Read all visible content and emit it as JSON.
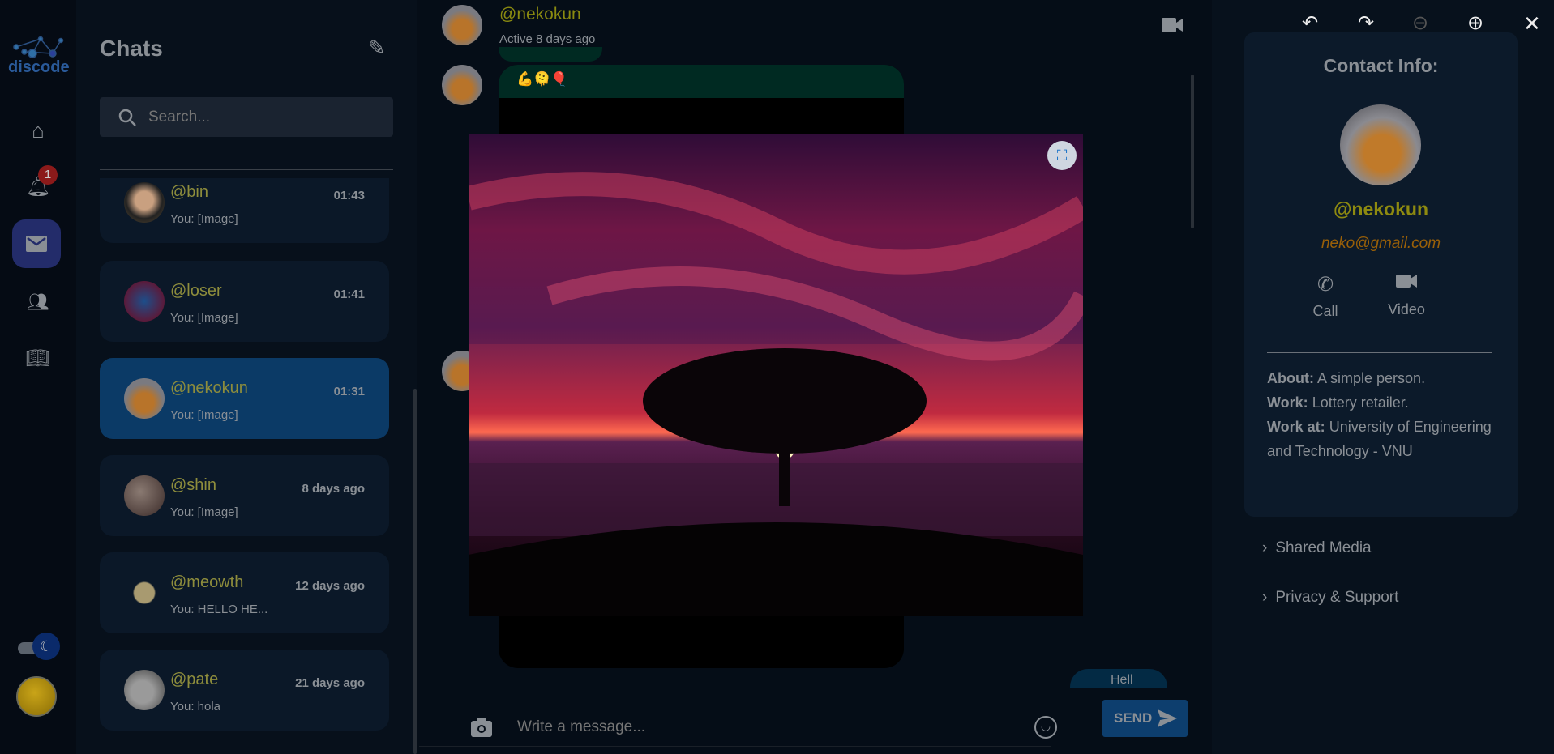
{
  "app": {
    "logo_text": "discode"
  },
  "rail": {
    "notification_count": "1",
    "items": [
      "home-icon",
      "bell-icon",
      "mail-icon",
      "groups-icon",
      "book-icon"
    ]
  },
  "chats": {
    "title": "Chats",
    "search_placeholder": "Search...",
    "items": [
      {
        "name": "@bin",
        "last": "You: [Image]",
        "time": "01:43"
      },
      {
        "name": "@loser",
        "last": "You: [Image]",
        "time": "01:41"
      },
      {
        "name": "@nekokun",
        "last": "You: [Image]",
        "time": "01:31",
        "active": true
      },
      {
        "name": "@shin",
        "last": "You: [Image]",
        "time": "8 days ago"
      },
      {
        "name": "@meowth",
        "last": "You: HELLO HE...",
        "time": "12 days ago"
      },
      {
        "name": "@pate",
        "last": "You: hola",
        "time": "21 days ago"
      }
    ]
  },
  "conversation": {
    "name": "@nekokun",
    "status": "Active 8 days ago",
    "emojis": "💪🫠🎈",
    "outgoing_preview": "Hell",
    "input_placeholder": "Write a message...",
    "send_label": "SEND"
  },
  "contact": {
    "title": "Contact Info:",
    "name": "@nekokun",
    "email": "neko@gmail.com",
    "call_label": "Call",
    "video_label": "Video",
    "about_label": "About:",
    "about": "A simple person.",
    "work_label": "Work:",
    "work": "Lottery retailer.",
    "work_at_label": "Work at:",
    "work_at": "University of Engineering and Technology - VNU",
    "sections": [
      "Shared Media",
      "Privacy & Support"
    ]
  },
  "colors": {
    "accent": "#0b3a66",
    "username": "#8e8d3c",
    "email": "#a0680a",
    "badge": "#b71c1c"
  }
}
